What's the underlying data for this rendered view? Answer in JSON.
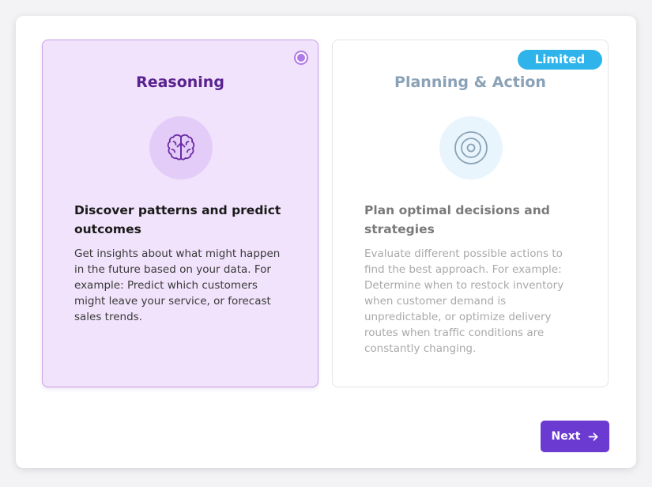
{
  "cards": [
    {
      "title": "Reasoning",
      "icon": "brain-icon",
      "heading": "Discover patterns and predict outcomes",
      "description": "Get insights about what might happen in the future based on your data. For example: Predict which customers might leave your service, or forecast sales trends.",
      "selected": true
    },
    {
      "title": "Planning & Action",
      "icon": "target-icon",
      "badge": "Limited",
      "heading": "Plan optimal decisions and strategies",
      "description": "Evaluate different possible actions to find the best approach. For example: Determine when to restock inventory when customer demand is unpredictable, or optimize delivery routes when traffic conditions are constantly changing.",
      "selected": false
    }
  ],
  "footer": {
    "next_label": "Next",
    "next_icon": "arrow-right-icon"
  },
  "colors": {
    "accent": "#6a3ad1",
    "selected_bg": "#f1e3fb",
    "selected_border": "#c9a2e6",
    "badge": "#2eb4ea"
  }
}
